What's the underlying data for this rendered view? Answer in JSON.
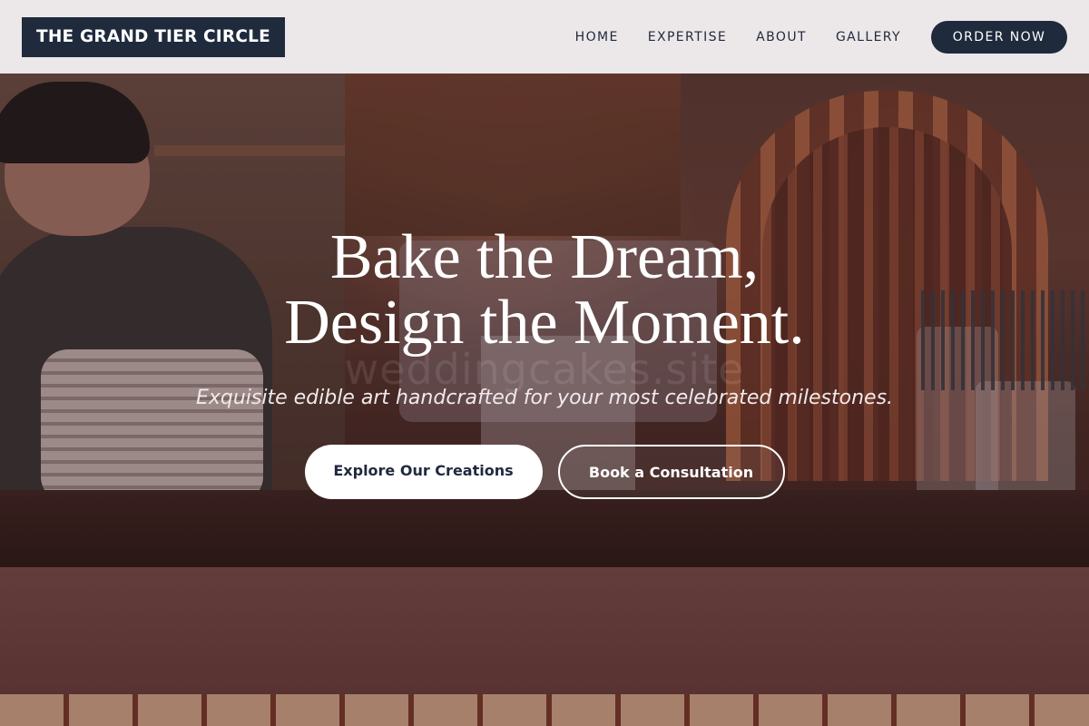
{
  "header": {
    "brand": "THE GRAND TIER CIRCLE",
    "nav": [
      {
        "label": "HOME"
      },
      {
        "label": "EXPERTISE"
      },
      {
        "label": "ABOUT"
      },
      {
        "label": "GALLERY"
      }
    ],
    "cta_label": "ORDER NOW"
  },
  "hero": {
    "headline_line1": "Bake the Dream,",
    "headline_line2": "Design the Moment.",
    "tagline": "Exquisite edible art handcrafted for your most celebrated milestones.",
    "watermark": "weddingcakes.site",
    "primary_button": "Explore Our Creations",
    "secondary_button": "Book a Consultation",
    "background_image": "bakery-counter-scene"
  },
  "colors": {
    "brand_navy": "#1f2a3d",
    "header_bg": "#f2eef0",
    "white": "#ffffff"
  }
}
